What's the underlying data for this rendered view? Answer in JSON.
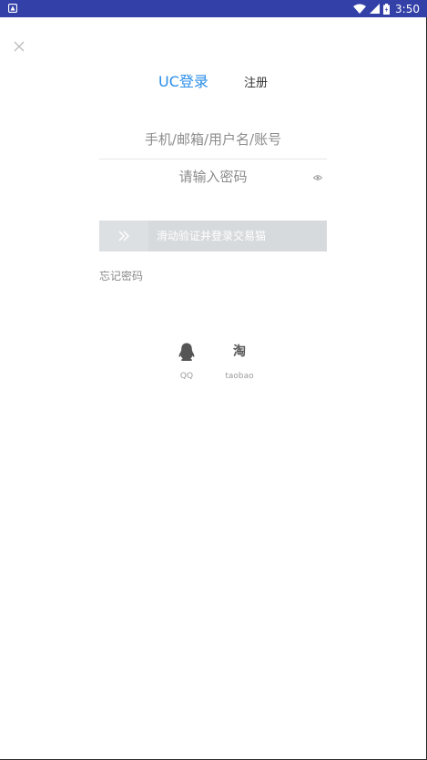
{
  "status_bar": {
    "time": "3:50",
    "bg_color": "#3340a8",
    "icons": [
      "app-notification-icon",
      "wifi-icon",
      "signal-icon",
      "battery-icon"
    ]
  },
  "header": {
    "close_icon": "close-icon"
  },
  "tabs": {
    "login_label": "UC登录",
    "register_label": "注册",
    "active_color": "#2b8ee8"
  },
  "form": {
    "account_placeholder": "手机/邮箱/用户名/账号",
    "password_placeholder": "请输入密码",
    "password_toggle_icon": "eye-icon"
  },
  "slider": {
    "label": "滑动验证并登录交易猫",
    "handle_icon": "double-chevron-right-icon",
    "progress": 0
  },
  "forgot": {
    "label": "忘记密码"
  },
  "social_login": [
    {
      "name": "qq",
      "label": "QQ",
      "icon": "qq-penguin-icon"
    },
    {
      "name": "taobao",
      "label": "taobao",
      "icon": "taobao-icon",
      "glyph": "淘"
    }
  ]
}
